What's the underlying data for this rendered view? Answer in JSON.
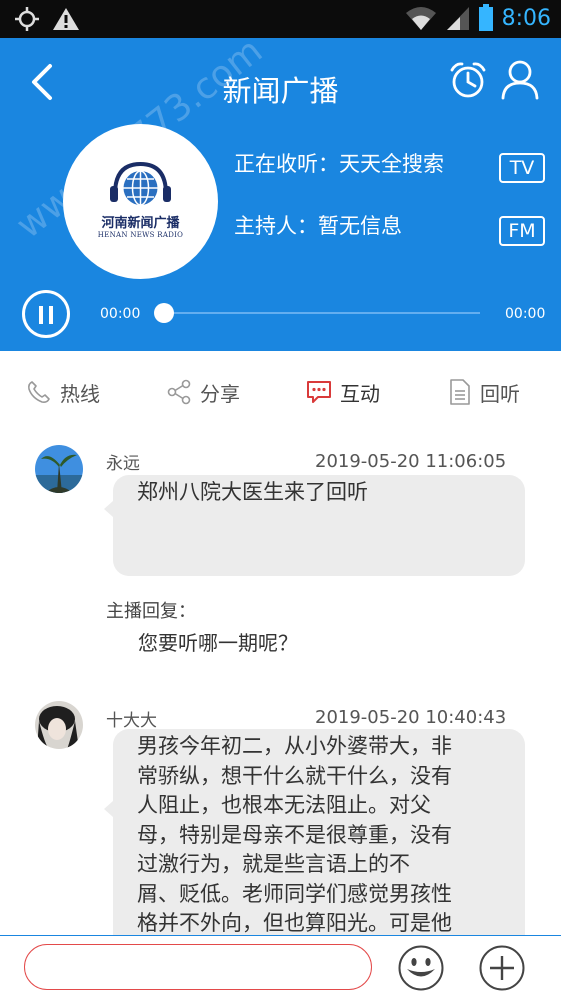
{
  "status_bar": {
    "time": "8:06"
  },
  "header": {
    "title": "新闻广播",
    "logo": {
      "name_cn": "河南新闻广播",
      "name_en": "HENAN NEWS RADIO"
    },
    "now_playing": "正在收听：天天全搜索",
    "host": "主持人：暂无信息",
    "tv_label": "TV",
    "fm_label": "FM",
    "time_start": "00:00",
    "time_end": "00:00",
    "progress": 0
  },
  "tabs": [
    {
      "label": "热线",
      "icon": "phone-icon"
    },
    {
      "label": "分享",
      "icon": "share-icon"
    },
    {
      "label": "互动",
      "icon": "chat-icon"
    },
    {
      "label": "回听",
      "icon": "document-icon"
    }
  ],
  "comments": [
    {
      "author": "永远",
      "timestamp": "2019-05-20 11:06:05",
      "text": "郑州八院大医生来了回听",
      "reply_label": "主播回复：",
      "reply_text": "您要听哪一期呢？"
    },
    {
      "author": "十大大",
      "timestamp": "2019-05-20 10:40:43",
      "text_lines": [
        "男孩今年初二，从小外婆带大，非",
        "常骄纵，想干什么就干什么，没有",
        "人阻止，也根本无法阻止。对父",
        "母，特别是母亲不是很尊重，没有",
        "过激行为，就是些言语上的不",
        "屑、贬低。老师同学们感觉男孩性",
        "格并不外向，但也算阳光。可是他"
      ]
    }
  ],
  "input": {
    "value": "",
    "placeholder": ""
  },
  "watermark": "www.11773.com",
  "colors": {
    "header_blue": "#1a86e0",
    "interact_red": "#d93a3a",
    "input_border": "#e34a4a"
  }
}
